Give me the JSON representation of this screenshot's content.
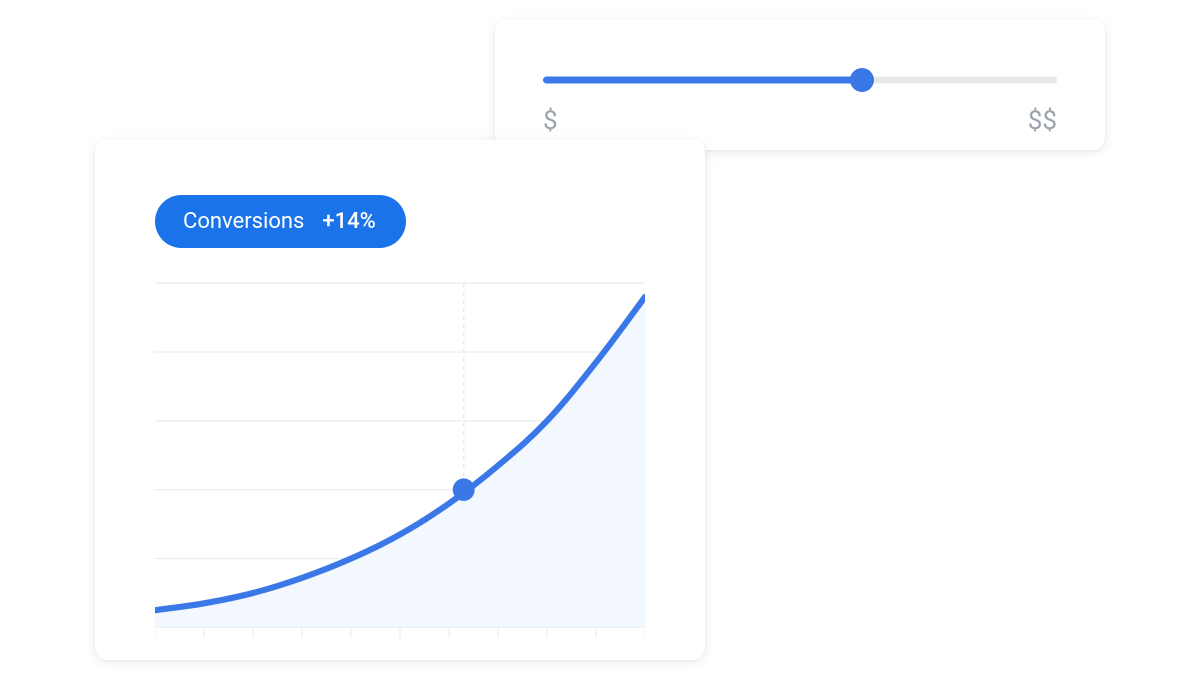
{
  "slider": {
    "min_label": "$",
    "max_label": "$$",
    "value_pct": 62
  },
  "badge": {
    "label": "Conversions",
    "delta": "+14%"
  },
  "chart_data": {
    "type": "line",
    "title": "",
    "xlabel": "",
    "ylabel": "",
    "xlim": [
      0,
      10
    ],
    "ylim": [
      0,
      5
    ],
    "grid": true,
    "series": [
      {
        "name": "Conversions",
        "x": [
          0,
          1,
          2,
          3,
          4,
          5,
          6,
          7,
          8,
          9,
          10
        ],
        "y": [
          0.25,
          0.35,
          0.5,
          0.72,
          1.0,
          1.35,
          1.8,
          2.35,
          3.0,
          3.85,
          4.8
        ]
      }
    ],
    "highlight": {
      "x": 6.3,
      "y": 2.0
    }
  },
  "colors": {
    "accent": "#3b78e7",
    "badge_bg": "#1a73e8",
    "grid": "#e6e8eb",
    "area_fill": "#f3f7fe",
    "slider_bg": "#e5e7eb",
    "label_grey": "#9ca3af"
  }
}
